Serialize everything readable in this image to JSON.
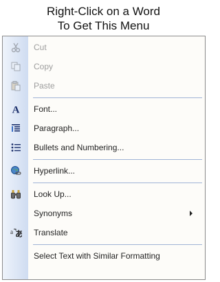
{
  "caption": {
    "line1": "Right-Click on a Word",
    "line2": "To Get This Menu"
  },
  "menu": {
    "items": [
      {
        "label": "Cut",
        "icon": "scissors-icon",
        "enabled": false
      },
      {
        "label": "Copy",
        "icon": "copy-icon",
        "enabled": false
      },
      {
        "label": "Paste",
        "icon": "paste-icon",
        "enabled": false
      },
      {
        "label": "Font...",
        "icon": "font-icon",
        "enabled": true
      },
      {
        "label": "Paragraph...",
        "icon": "paragraph-icon",
        "enabled": true
      },
      {
        "label": "Bullets and Numbering...",
        "icon": "bullets-icon",
        "enabled": true
      },
      {
        "label": "Hyperlink...",
        "icon": "hyperlink-icon",
        "enabled": true
      },
      {
        "label": "Look Up...",
        "icon": "binoculars-icon",
        "enabled": true
      },
      {
        "label": "Synonyms",
        "icon": "",
        "enabled": true,
        "submenu": true
      },
      {
        "label": "Translate",
        "icon": "translate-icon",
        "enabled": true
      },
      {
        "label": "Select Text with Similar Formatting",
        "icon": "",
        "enabled": true
      }
    ]
  },
  "colors": {
    "menu_border": "#8a8a8a",
    "gutter_start": "#eef3fb",
    "gutter_end": "#cfdcf1",
    "separator": "#9fb3d6",
    "disabled_text": "#9d9d9d"
  }
}
